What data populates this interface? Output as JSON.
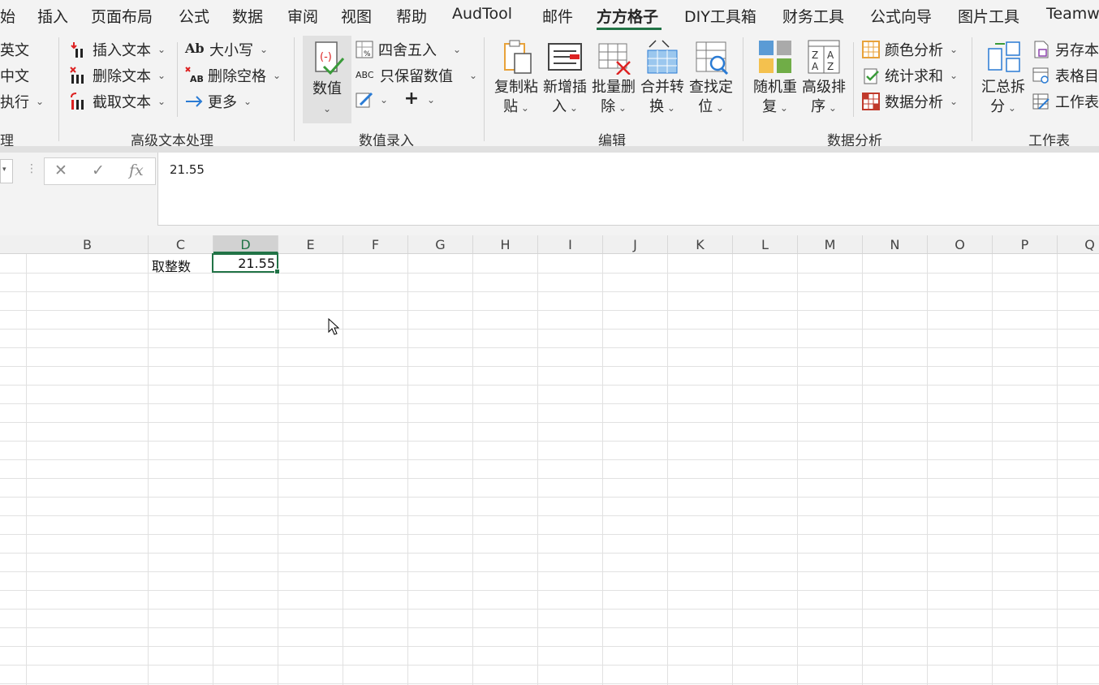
{
  "menu": {
    "tabs": [
      "始",
      "插入",
      "页面布局",
      "公式",
      "数据",
      "审阅",
      "视图",
      "帮助",
      "AudTool",
      "邮件",
      "方方格子",
      "DIY工具箱",
      "财务工具",
      "公式向导",
      "图片工具",
      "Teamw"
    ],
    "active_index": 10
  },
  "ribbon": {
    "partial_group": {
      "items": [
        "英文",
        "中文",
        "执行"
      ],
      "label": "理"
    },
    "text_group": {
      "label": "高级文本处理",
      "insert_text": "插入文本",
      "delete_text": "删除文本",
      "cut_text": "截取文本",
      "case": "大小写",
      "delete_space": "删除空格",
      "more": "更多"
    },
    "number_group": {
      "label": "数值录入",
      "value_btn": "数值",
      "round": "四舍五入",
      "keep_value": "只保留数值"
    },
    "edit_group": {
      "label": "编辑",
      "copy_paste": [
        "复制粘",
        "贴"
      ],
      "insert_new": [
        "新增插",
        "入"
      ],
      "batch_delete": [
        "批量删",
        "除"
      ],
      "merge_convert": [
        "合并转",
        "换"
      ],
      "find_locate": [
        "查找定",
        "位"
      ]
    },
    "analysis_group": {
      "label": "数据分析",
      "random_repeat": [
        "随机重",
        "复"
      ],
      "advanced_sort": [
        "高级排",
        "序"
      ],
      "color_analysis": "颜色分析",
      "stat_sum": "统计求和",
      "data_analysis": "数据分析"
    },
    "sheet_group": {
      "label": "工作表",
      "summary_split": [
        "汇总拆",
        "分"
      ],
      "save_as": "另存本",
      "table_dir": "表格目",
      "worksheet": "工作表"
    }
  },
  "formula_bar": {
    "value": "21.55",
    "cancel_glyph": "✕",
    "confirm_glyph": "✓",
    "fx_glyph": "fx"
  },
  "sheet": {
    "columns": [
      "B",
      "C",
      "D",
      "E",
      "F",
      "G",
      "H",
      "I",
      "J",
      "K",
      "L",
      "M",
      "N",
      "O",
      "P",
      "Q"
    ],
    "selected_column": "D",
    "cells": {
      "C1": "取整数",
      "D1": "21.55"
    }
  }
}
